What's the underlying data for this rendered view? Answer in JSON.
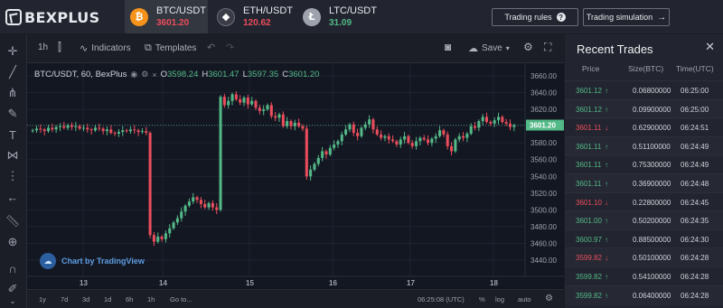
{
  "brand": {
    "name": "BEXPLUS"
  },
  "tickers": [
    {
      "pair": "BTC/USDT",
      "price": "3601.20",
      "color": "#eb4d5c",
      "icon": "bitcoin-icon",
      "glyph": "₿",
      "bg": "#f7931a"
    },
    {
      "pair": "ETH/USDT",
      "price": "120.62",
      "color": "#eb4d5c",
      "icon": "ethereum-icon",
      "glyph": "◆",
      "bg": "#3a3d47"
    },
    {
      "pair": "LTC/USDT",
      "price": "31.09",
      "color": "#53b987",
      "icon": "litecoin-icon",
      "glyph": "Ł",
      "bg": "#9ea2ad"
    }
  ],
  "buttons": {
    "trading_rules": "Trading rules",
    "trading_simulation": "Trading simulation"
  },
  "chart_toolbar": {
    "interval": "1h",
    "indicators": "Indicators",
    "templates": "Templates",
    "save": "Save"
  },
  "chart_legend": {
    "symbol": "BTC/USDT, 60, BexPlus",
    "o_label": "O",
    "o": "3598.24",
    "h_label": "H",
    "h": "3601.47",
    "l_label": "L",
    "l": "3597.35",
    "c_label": "C",
    "c": "3601.20"
  },
  "watermark": "Chart by TradingView",
  "bottom_bar": {
    "ranges": [
      "1y",
      "7d",
      "3d",
      "1d",
      "6h",
      "1h"
    ],
    "goto": "Go to...",
    "time": "06:25:08 (UTC)",
    "pct": "%",
    "log": "log",
    "auto": "auto"
  },
  "chart_data": {
    "type": "candlestick",
    "symbol": "BTC/USDT",
    "interval": "60",
    "y_ticks": [
      "3660.00",
      "3640.00",
      "3620.00",
      "3600.00",
      "3580.00",
      "3560.00",
      "3540.00",
      "3520.00",
      "3500.00",
      "3480.00",
      "3460.00",
      "3440.00"
    ],
    "ylim": [
      3440,
      3660
    ],
    "x_ticks": [
      "13",
      "14",
      "15",
      "16",
      "17",
      "18"
    ],
    "last_price": "3601.20",
    "colors": {
      "up": "#53b987",
      "down": "#eb4d5c"
    },
    "candles_close": [
      3595,
      3597,
      3596,
      3594,
      3598,
      3596,
      3599,
      3600,
      3598,
      3601,
      3599,
      3600,
      3597,
      3598,
      3596,
      3595,
      3598,
      3597,
      3594,
      3596,
      3592,
      3591,
      3593,
      3595,
      3594,
      3596,
      3595,
      3593,
      3594,
      3592,
      3470,
      3462,
      3468,
      3465,
      3472,
      3478,
      3485,
      3490,
      3498,
      3505,
      3510,
      3515,
      3512,
      3507,
      3503,
      3508,
      3503,
      3500,
      3635,
      3625,
      3630,
      3638,
      3632,
      3628,
      3634,
      3626,
      3630,
      3622,
      3618,
      3620,
      3625,
      3612,
      3610,
      3614,
      3600,
      3606,
      3600,
      3604,
      3600,
      3597,
      3540,
      3548,
      3555,
      3562,
      3570,
      3566,
      3574,
      3578,
      3582,
      3590,
      3596,
      3602,
      3592,
      3588,
      3598,
      3602,
      3608,
      3596,
      3590,
      3586,
      3588,
      3584,
      3582,
      3578,
      3584,
      3588,
      3580,
      3576,
      3582,
      3586,
      3584,
      3580,
      3585,
      3588,
      3595,
      3590,
      3576,
      3570,
      3584,
      3588,
      3586,
      3591,
      3600,
      3598,
      3606,
      3611,
      3605,
      3603,
      3607,
      3611,
      3605,
      3603,
      3599,
      3601
    ]
  },
  "recent_trades": {
    "title": "Recent Trades",
    "columns": [
      "Price",
      "Size(BTC)",
      "Time(UTC)"
    ],
    "rows": [
      {
        "price": "3601.12",
        "dir": "up",
        "size": "0.06800000",
        "time": "06:25:00"
      },
      {
        "price": "3601.12",
        "dir": "up",
        "size": "0.09900000",
        "time": "06:25:00"
      },
      {
        "price": "3601.11",
        "dir": "down",
        "size": "0.62900000",
        "time": "06:24:51"
      },
      {
        "price": "3601.11",
        "dir": "up",
        "size": "0.51100000",
        "time": "06:24:49"
      },
      {
        "price": "3601.11",
        "dir": "up",
        "size": "0.75300000",
        "time": "06:24:49"
      },
      {
        "price": "3601.11",
        "dir": "up",
        "size": "0.36900000",
        "time": "06:24:48"
      },
      {
        "price": "3601.10",
        "dir": "down",
        "size": "0.22800000",
        "time": "06:24:45"
      },
      {
        "price": "3601.00",
        "dir": "up",
        "size": "0.50200000",
        "time": "06:24:35"
      },
      {
        "price": "3600.97",
        "dir": "up",
        "size": "0.88500000",
        "time": "06:24:30"
      },
      {
        "price": "3599.82",
        "dir": "down",
        "size": "0.50100000",
        "time": "06:24:28"
      },
      {
        "price": "3599.82",
        "dir": "up",
        "size": "0.54100000",
        "time": "06:24:28"
      },
      {
        "price": "3599.82",
        "dir": "up",
        "size": "0.06400000",
        "time": "06:24:28"
      }
    ]
  }
}
